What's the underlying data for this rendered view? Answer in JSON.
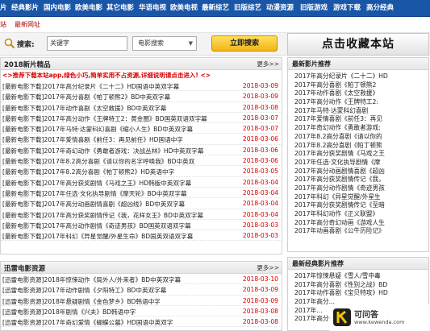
{
  "nav": {
    "items": [
      "片",
      "经典影片",
      "国内电影",
      "欧美电影",
      "其它电影",
      "华语电视",
      "欧美电视",
      "最新综艺",
      "旧版综艺",
      "动漫资源",
      "旧版游戏",
      "游戏下载",
      "高分经典"
    ]
  },
  "subnav": {
    "left_link": "站",
    "right_link": "最新网址"
  },
  "search": {
    "label": "搜索:",
    "value": "关键字",
    "select_value": "电影搜索",
    "button_label": "立即搜索"
  },
  "favorite_button": "点击收藏本站",
  "new_panel": {
    "title": "2018新片精品",
    "more": "更多>>",
    "notice": "<>推荐下载本站app,绿色小巧,简单实用不占资源,详细说明请点击进入! <>",
    "rows": [
      {
        "title": "[最新电影下载]2017年高分纪录片《二十二》HD国语中英双字幕",
        "date": "2018-03-09"
      },
      {
        "title": "[最新电影下载]2017年高分喜剧《帕丁顿熊2》BD中英双字幕",
        "date": "2018-03-09"
      },
      {
        "title": "[最新电影下载]2017年动作喜剧《太空救援》BD中英双字幕",
        "date": "2018-03-08"
      },
      {
        "title": "[最新电影下载]2017年高分动作《王牌特工2：黄金圈》BD国英双语双字幕",
        "date": "2018-03-07"
      },
      {
        "title": "[最新电影下载]2017年马特·达蒙科幻喜剧《缩小人生》BD中英双字幕",
        "date": "2018-03-07"
      },
      {
        "title": "[最新电影下载]2017年爱情喜剧《前任3：再见前任》HD国语中字",
        "date": "2018-03-06"
      },
      {
        "title": "[最新电影下载]2017年奇幻动作《勇敢者游戏：决战丛林》HD中英双字幕",
        "date": "2018-03-06"
      },
      {
        "title": "[最新电影下载]2017年8.2高分喜剧《请以你的名字呼唤我》BD中英双",
        "date": "2018-03-06"
      },
      {
        "title": "[最新电影下载]2017年8.2高分喜剧《帕丁顿熊2》HD英语中字",
        "date": "2018-03-05"
      },
      {
        "title": "[最新电影下载]2017年高分获奖剧情《马戏之王》HD韩版中英双字幕",
        "date": "2018-03-04"
      },
      {
        "title": "[最新电影下载]2017年任选·文化执导剧情《摩天轮》BD中英双字幕",
        "date": "2018-03-04"
      },
      {
        "title": "[最新电影下载]2017年高分动画剧情喜剧《超凶线》BD中英双字幕",
        "date": "2018-03-04"
      },
      {
        "title": "[最新电影下载]2017年高分获奖剧情传记《我，花样女王》BD中英双字幕",
        "date": "2018-03-04"
      },
      {
        "title": "[最新电影下载]2017年高分动作剧情《奇迹男孩》BD国英双语双字幕",
        "date": "2018-03-03"
      },
      {
        "title": "[最新电影下载]2017年科幻《异星觉醒/外星生命》BD国英双语双字幕",
        "date": "2018-03-03"
      }
    ]
  },
  "xunlei_panel": {
    "title": "迅雷电影资源",
    "more": "更多>>",
    "rows": [
      {
        "title": "[迅雷电影资源]2018年惊悚动作《局外人/外来者》BD中英双字幕",
        "date": "2018-03-10"
      },
      {
        "title": "[迅雷电影资源]2017年动作剧情《夕阳特工》BD中英双字幕",
        "date": "2018-03-09"
      },
      {
        "title": "[迅雷电影资源]2018年悬疑剧情《金色梦乡》BD韩语中字",
        "date": "2018-03-09"
      },
      {
        "title": "[迅雷电影资源]2018年剧情《兴夫》BD韩语中字",
        "date": "2018-03-08"
      },
      {
        "title": "[迅雷电影资源]2017年奇幻爱情《蝴蝶公墓》HD国语中英双字",
        "date": "2018-03-08"
      }
    ]
  },
  "recommend": {
    "title": "最新影片推荐",
    "items": [
      "2017年高分纪录片《二十二》HD",
      "2017年高分喜剧《帕丁顿熊2",
      "2017年动作喜剧《太空救援》",
      "2017年高分动作《王牌特工2:",
      "2017年马特·达蒙科幻喜剧",
      "2017年爱情喜剧《前任3：再见",
      "2017年奇幻动作《勇敢者游戏:",
      "2017年8.2高分喜剧《请以你的",
      "2017年8.2高分喜剧《帕丁顿熊",
      "2017年高分获奖剧情《马戏之王",
      "2017年任选·文化执导剧情《摩",
      "2017年高分动画剧情喜剧《超凶",
      "2017年高分获奖剧情传记《我，",
      "2017年高分动作剧情《奇迹男孩",
      "2017年科幻《异星觉醒/外星生",
      "2017年高分获奖剧情传记《至暗",
      "2017年科幻动作《正义联盟》",
      "2017年高分奇幻动画《游戏人生",
      "2017年动画喜剧《公牛历险记》"
    ]
  },
  "classic": {
    "title": "最新经典影片推荐",
    "items": [
      "2017年惊悚悬疑《雪人/雪中毒",
      "2017年高分喜剧《性别之战》BD",
      "2017年动作喜剧《宝贝特攻》HD",
      "2017年高分...",
      "2017年...",
      "2017年高分经典《奴隶..."
    ]
  },
  "watermark": {
    "text": "可问答",
    "url": "www.kewenda.com"
  }
}
